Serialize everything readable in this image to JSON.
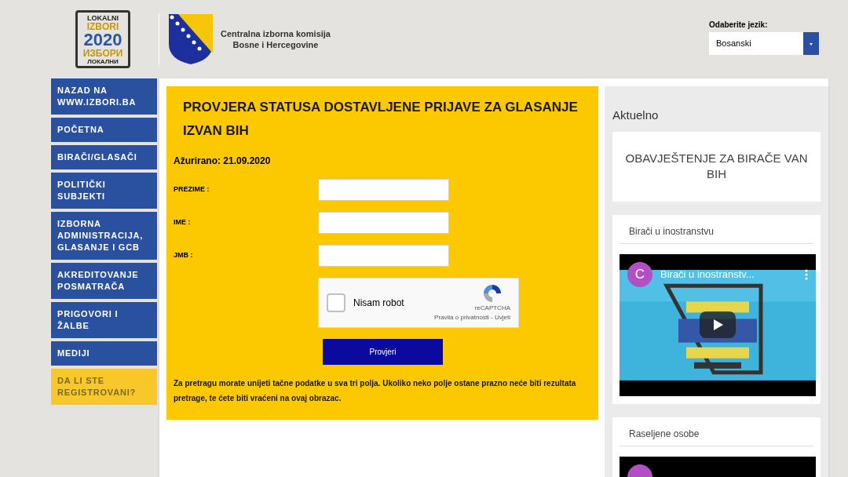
{
  "header": {
    "logo_lines": [
      "LOKALNI",
      "IZBORI",
      "2020",
      "ИЗБОРИ",
      "ЛОКАЛНИ"
    ],
    "institution": [
      "Centralna izborna komisija",
      "Bosne i Hercegovine"
    ],
    "language": {
      "label": "Odaberite jezik:",
      "value": "Bosanski"
    }
  },
  "sidebar": {
    "items": [
      {
        "label": "NAZAD NA WWW.IZBORI.BA",
        "selected": false
      },
      {
        "label": "POČETNA",
        "selected": false
      },
      {
        "label": "BIRAČI/GLASAČI",
        "selected": false
      },
      {
        "label": "POLITIČKI SUBJEKTI",
        "selected": false
      },
      {
        "label": "IZBORNA ADMINISTRACIJA, GLASANJE I GCB",
        "selected": false
      },
      {
        "label": "AKREDITOVANJE POSMATRAČA",
        "selected": false
      },
      {
        "label": "PRIGOVORI I ŽALBE",
        "selected": false
      },
      {
        "label": "MEDIJI",
        "selected": false
      },
      {
        "label": "DA LI STE REGISTROVANI?",
        "selected": true
      }
    ]
  },
  "form": {
    "title": "PROVJERA STATUSA DOSTAVLJENE PRIJAVE ZA GLASANJE IZVAN BIH",
    "updated": "Ažurirano: 21.09.2020",
    "fields": [
      {
        "label": "PREZIME :"
      },
      {
        "label": "IME :"
      },
      {
        "label": "JMB :"
      }
    ],
    "captcha": {
      "label": "Nisam robot",
      "checked": false,
      "brand": "reCAPTCHA",
      "links": "Pravila o privatnosti - Uvjeti"
    },
    "submit": "Provjeri",
    "note": "Za pretragu morate unijeti tačne podatke u sva tri polja. Ukoliko neko polje ostane prazno neće biti rezultata pretrage, te ćete biti vraćeni na ovaj obrazac."
  },
  "news": {
    "title": "Aktuelno",
    "notice": "OBAVJEŠTENJE ZA BIRAČE VAN BIH",
    "videos": [
      {
        "title": "Birači u inostranstvu",
        "avatar": "C",
        "video_title": "Birači u inostranstv..."
      },
      {
        "title": "Raseljene osobe"
      }
    ]
  }
}
